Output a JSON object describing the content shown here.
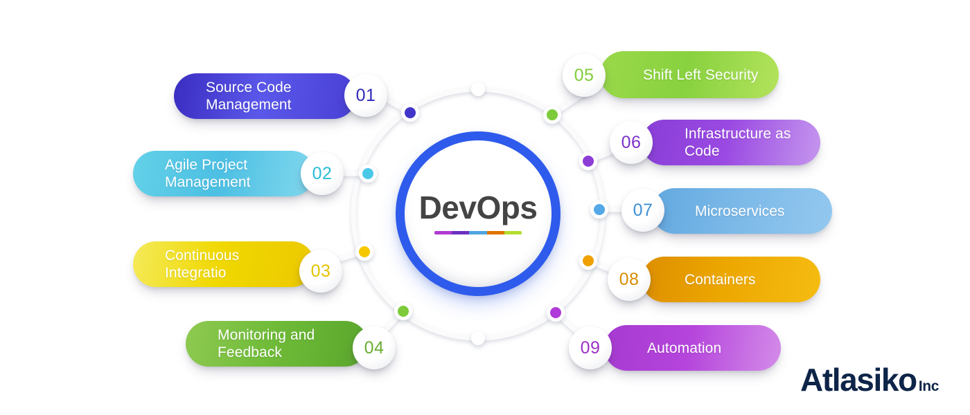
{
  "center": {
    "title": "DevOps",
    "underline_colors": [
      "#b13ad1",
      "#6d2fc0",
      "#4da6e0",
      "#e07400",
      "#b4dd30"
    ]
  },
  "brand": {
    "name": "Atlasiko",
    "suffix": "Inc",
    "color": "#0e2448"
  },
  "chart_data": {
    "type": "diagram",
    "title": "DevOps",
    "layout": "radial hub with nine labelled pill spokes",
    "node_count": 9,
    "nodes": [
      {
        "number": "01",
        "label": "Source Code\nManagement",
        "side": "left",
        "dot_color": "#4334c9",
        "gradient": [
          "#3a2cc0",
          "#5a58ea",
          "#4a3fd6"
        ],
        "number_color": "#2f28b8"
      },
      {
        "number": "02",
        "label": "Agile Project\nManagement",
        "side": "left",
        "dot_color": "#49c8e8",
        "gradient": [
          "#63d1e8",
          "#4cbfe3",
          "#83d9ee"
        ],
        "number_color": "#2cbcd6"
      },
      {
        "number": "03",
        "label": "Continuous\nIntegratio",
        "side": "left",
        "dot_color": "#f5c800",
        "gradient": [
          "#f4ea5a",
          "#f0d800",
          "#ecc800"
        ],
        "number_color": "#e2c400"
      },
      {
        "number": "04",
        "label": "Monitoring and\nFeedback",
        "side": "left",
        "dot_color": "#7dcb3a",
        "gradient": [
          "#8ec951",
          "#6fbb38",
          "#5aa62c"
        ],
        "number_color": "#6aad33"
      },
      {
        "number": "05",
        "label": "Shift Left Security",
        "side": "right",
        "dot_color": "#7dcb3a",
        "gradient": [
          "#9ad94a",
          "#88d13f",
          "#b3e35c"
        ],
        "number_color": "#82cc3c"
      },
      {
        "number": "06",
        "label": "Infrastructure as\nCode",
        "side": "right",
        "dot_color": "#8b3ed6",
        "gradient": [
          "#8a3ed8",
          "#9a4ae2",
          "#c596ee"
        ],
        "number_color": "#7b32c8"
      },
      {
        "number": "07",
        "label": "Microservices",
        "side": "right",
        "dot_color": "#55a8e8",
        "gradient": [
          "#62a9e0",
          "#7cb9e8",
          "#93c8ef"
        ],
        "number_color": "#3d8fd4"
      },
      {
        "number": "08",
        "label": "Containers",
        "side": "right",
        "dot_color": "#f0a000",
        "gradient": [
          "#dd8e00",
          "#eda800",
          "#f5bc12"
        ],
        "number_color": "#d98c00"
      },
      {
        "number": "09",
        "label": "Automation",
        "side": "right",
        "dot_color": "#b03ad8",
        "gradient": [
          "#a63ad0",
          "#b545dc",
          "#d48ce9"
        ],
        "number_color": "#9b2fc6"
      }
    ],
    "ring": {
      "color": "#f1f2f5",
      "marker_color": "#ffffff",
      "marker_positions": [
        "top",
        "bottom"
      ]
    }
  }
}
